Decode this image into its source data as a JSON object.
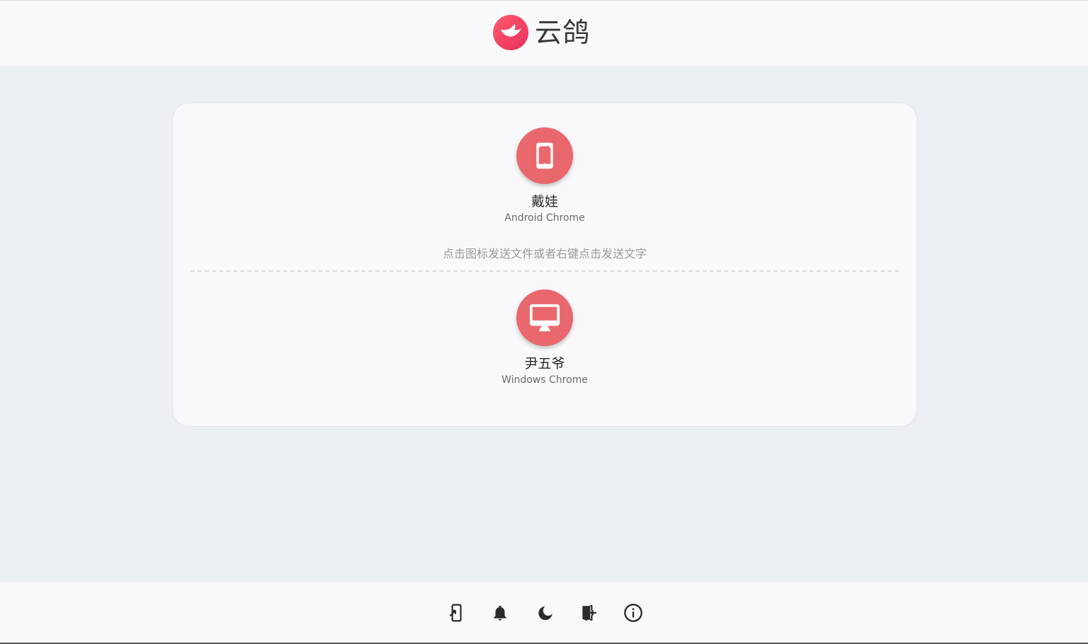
{
  "app": {
    "title": "云鸽",
    "logo_icon": "pigeon-logo-icon",
    "accent_color": "#e9686d"
  },
  "peers": [
    {
      "name": "戴娃",
      "device": "Android Chrome",
      "icon": "smartphone-icon"
    },
    {
      "name": "尹五爷",
      "device": "Windows Chrome",
      "icon": "desktop-monitor-icon"
    }
  ],
  "hint": "点击图标发送文件或者右键点击发送文字",
  "footer": {
    "buttons": [
      {
        "name": "install-app-button",
        "icon": "install-app-icon"
      },
      {
        "name": "notifications-button",
        "icon": "bell-icon"
      },
      {
        "name": "theme-toggle-button",
        "icon": "moon-icon"
      },
      {
        "name": "leave-button",
        "icon": "exit-door-icon"
      },
      {
        "name": "about-button",
        "icon": "info-icon"
      }
    ]
  }
}
